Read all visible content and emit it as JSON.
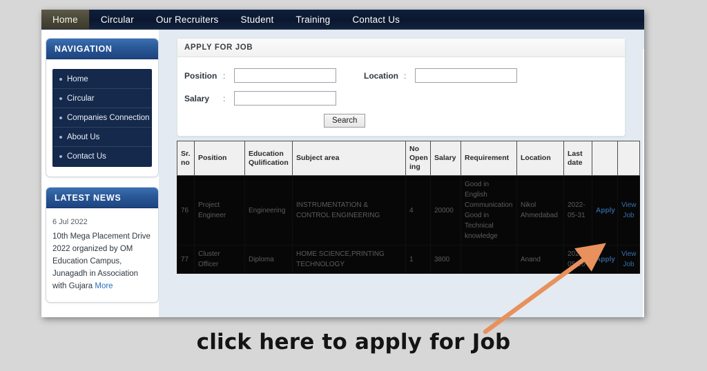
{
  "topnav": {
    "items": [
      {
        "label": "Home",
        "active": true
      },
      {
        "label": "Circular",
        "active": false
      },
      {
        "label": "Our Recruiters",
        "active": false
      },
      {
        "label": "Student",
        "active": false
      },
      {
        "label": "Training",
        "active": false
      },
      {
        "label": "Contact Us",
        "active": false
      }
    ]
  },
  "sidebar": {
    "navigation": {
      "title": "NAVIGATION",
      "items": [
        {
          "label": "Home"
        },
        {
          "label": "Circular"
        },
        {
          "label": "Companies Connection"
        },
        {
          "label": "About Us"
        },
        {
          "label": "Contact Us"
        }
      ]
    },
    "latest_news": {
      "title": "LATEST NEWS",
      "date": "6 Jul 2022",
      "text": "10th Mega Placement Drive 2022 organized by OM Education Campus, Junagadh in Association with Gujara",
      "more_label": "More"
    }
  },
  "main": {
    "card_title": "APPLY FOR JOB",
    "form": {
      "position_label": "Position",
      "position_value": "",
      "location_label": "Location",
      "location_value": "",
      "salary_label": "Salary",
      "salary_value": "",
      "colon": ":",
      "search_label": "Search"
    },
    "table": {
      "headers": [
        "Sr. no",
        "Position",
        "Education Qulification",
        "Subject area",
        "No Open ing",
        "Salary",
        "Requirement",
        "Location",
        "Last date",
        "",
        ""
      ],
      "rows": [
        {
          "sr_no": "76",
          "position": "Project Engineer",
          "education": "Engineering",
          "subject_area": "INSTRUMENTATION & CONTROL ENGINEERING",
          "no_opening": "4",
          "salary": "20000",
          "requirement": "Good in English Communication Good in Technical knowledge",
          "location": "Nikol Ahmedabad",
          "last_date": "2022-05-31",
          "apply_label": "Apply",
          "view_label": "View Job"
        },
        {
          "sr_no": "77",
          "position": "Cluster Officer",
          "education": "Diploma",
          "subject_area": "HOME SCIENCE,PRINTING TECHNOLOGY",
          "no_opening": "1",
          "salary": "3800",
          "requirement": "",
          "location": "Anand",
          "last_date": "2022-05-26",
          "apply_label": "Apply",
          "view_label": "View Job"
        }
      ]
    }
  },
  "annotation": {
    "caption": "click here to apply for Job",
    "arrow_color": "#e8915c"
  }
}
